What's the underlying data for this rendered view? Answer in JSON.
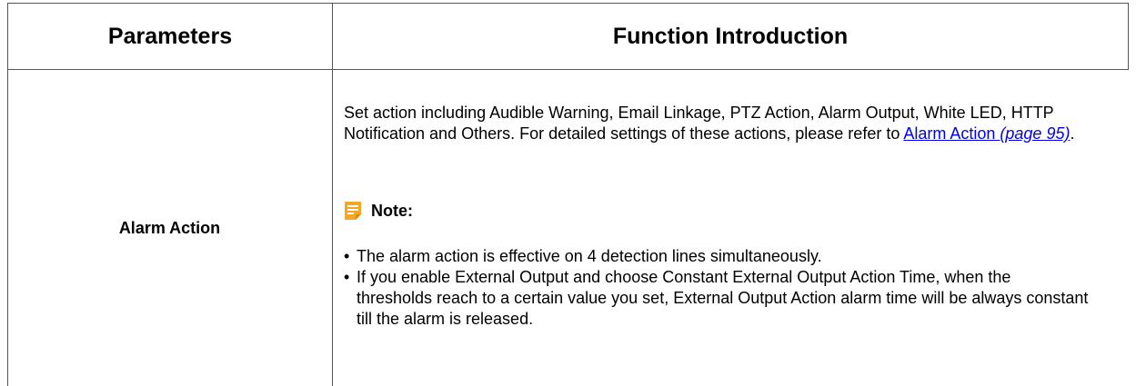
{
  "table": {
    "headers": {
      "parameters": "Parameters",
      "function_introduction": "Function Introduction"
    },
    "rows": [
      {
        "parameter": "Alarm Action",
        "description_pre": "Set action including Audible Warning, Email Linkage, PTZ Action, Alarm Output, White LED, HTTP Notification and Others. For detailed settings of these actions, please refer to ",
        "link_text": "Alarm Action",
        "link_page": "(page 95)",
        "description_post": ".",
        "note_label": "Note:",
        "note_icon": "note-icon",
        "note_icon_color": "#f5a623",
        "bullets": [
          "The alarm action is effective on 4 detection lines simultaneously.",
          "If you enable External Output and choose Constant External Output Action Time, when the thresholds reach to a certain value you set, External Output Action alarm time will be always constant till the alarm is released."
        ]
      }
    ]
  }
}
